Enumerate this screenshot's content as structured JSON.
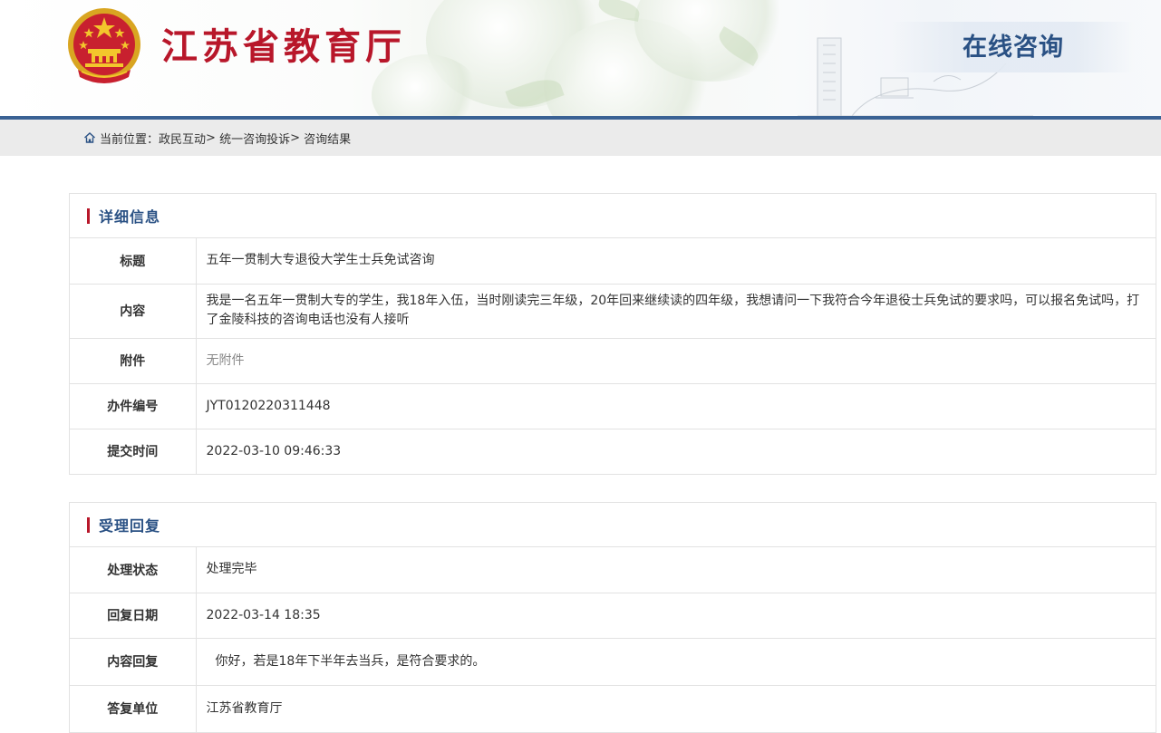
{
  "header": {
    "site_title": "江苏省教育厅",
    "section_title": "在线咨询",
    "brand_color": "#b8172a",
    "accent_color": "#2a5184"
  },
  "breadcrumb": {
    "icon": "home-icon",
    "prefix": "当前位置：",
    "items": [
      "政民互动",
      "统一咨询投诉",
      "咨询结果"
    ],
    "separator": ">"
  },
  "detail": {
    "heading": "详细信息",
    "rows": [
      {
        "label": "标题",
        "value": "五年一贯制大专退役大学生士兵免试咨询"
      },
      {
        "label": "内容",
        "value": "我是一名五年一贯制大专的学生，我18年入伍，当时刚读完三年级，20年回来继续读的四年级，我想请问一下我符合今年退役士兵免试的要求吗，可以报名免试吗，打了金陵科技的咨询电话也没有人接听"
      },
      {
        "label": "附件",
        "value": "无附件"
      },
      {
        "label": "办件编号",
        "value": "JYT0120220311448"
      },
      {
        "label": "提交时间",
        "value": "2022-03-10 09:46:33"
      }
    ]
  },
  "reply": {
    "heading": "受理回复",
    "rows": [
      {
        "label": "处理状态",
        "value": "处理完毕"
      },
      {
        "label": "回复日期",
        "value": "2022-03-14 18:35"
      },
      {
        "label": "内容回复",
        "value": "你好，若是18年下半年去当兵，是符合要求的。"
      },
      {
        "label": "答复单位",
        "value": "江苏省教育厅"
      }
    ]
  }
}
